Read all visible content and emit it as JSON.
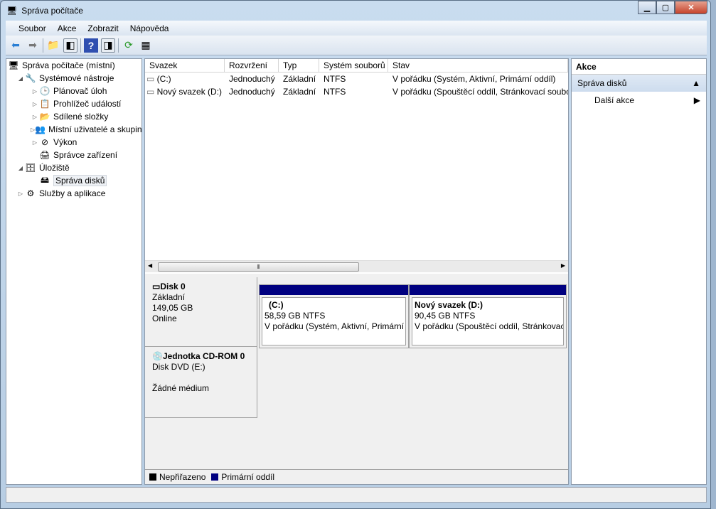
{
  "window": {
    "title": "Správa počítače"
  },
  "menu": [
    "Soubor",
    "Akce",
    "Zobrazit",
    "Nápověda"
  ],
  "tree": [
    {
      "label": "Správa počítače (místní)",
      "icon": "computer-icon",
      "level": 0,
      "arrow": ""
    },
    {
      "label": "Systémové nástroje",
      "icon": "tools-icon",
      "level": 1,
      "arrow": "◢"
    },
    {
      "label": "Plánovač úloh",
      "icon": "clock-icon",
      "level": 2,
      "arrow": "▷"
    },
    {
      "label": "Prohlížeč událostí",
      "icon": "event-viewer-icon",
      "level": 2,
      "arrow": "▷"
    },
    {
      "label": "Sdílené složky",
      "icon": "shared-folder-icon",
      "level": 2,
      "arrow": "▷"
    },
    {
      "label": "Místní uživatelé a skupiny",
      "icon": "users-icon",
      "level": 2,
      "arrow": "▷"
    },
    {
      "label": "Výkon",
      "icon": "performance-icon",
      "level": 2,
      "arrow": "▷"
    },
    {
      "label": "Správce zařízení",
      "icon": "device-manager-icon",
      "level": 2,
      "arrow": ""
    },
    {
      "label": "Úložiště",
      "icon": "storage-icon",
      "level": 1,
      "arrow": "◢"
    },
    {
      "label": "Správa disků",
      "icon": "disk-management-icon",
      "level": 2,
      "arrow": "",
      "selected": true
    },
    {
      "label": "Služby a aplikace",
      "icon": "services-icon",
      "level": 1,
      "arrow": "▷"
    }
  ],
  "volumes": {
    "columns": [
      "Svazek",
      "Rozvržení",
      "Typ",
      "Systém souborů",
      "Stav"
    ],
    "rows": [
      [
        "(C:)",
        "Jednoduchý",
        "Základní",
        "NTFS",
        "V pořádku (Systém, Aktivní, Primární oddíl)"
      ],
      [
        "Nový svazek (D:)",
        "Jednoduchý",
        "Základní",
        "NTFS",
        "V pořádku (Spouštěcí oddíl, Stránkovací soubor"
      ]
    ]
  },
  "disks": [
    {
      "name": "Disk 0",
      "type": "Základní",
      "size": "149,05 GB",
      "status": "Online",
      "partitions": [
        {
          "name": "(C:)",
          "size": "58,59 GB NTFS",
          "status": "V pořádku (Systém, Aktivní, Primární"
        },
        {
          "name": "Nový svazek  (D:)",
          "size": "90,45 GB NTFS",
          "status": "V pořádku (Spouštěcí oddíl, Stránkovac"
        }
      ]
    },
    {
      "name": "Jednotka CD-ROM 0",
      "type": "Disk DVD (E:)",
      "status": "Žádné médium"
    }
  ],
  "legend": [
    {
      "label": "Nepřiřazeno",
      "color": "#000000"
    },
    {
      "label": "Primární oddíl",
      "color": "#000080"
    }
  ],
  "actions": {
    "header": "Akce",
    "section": "Správa disků",
    "item": "Další akce"
  }
}
